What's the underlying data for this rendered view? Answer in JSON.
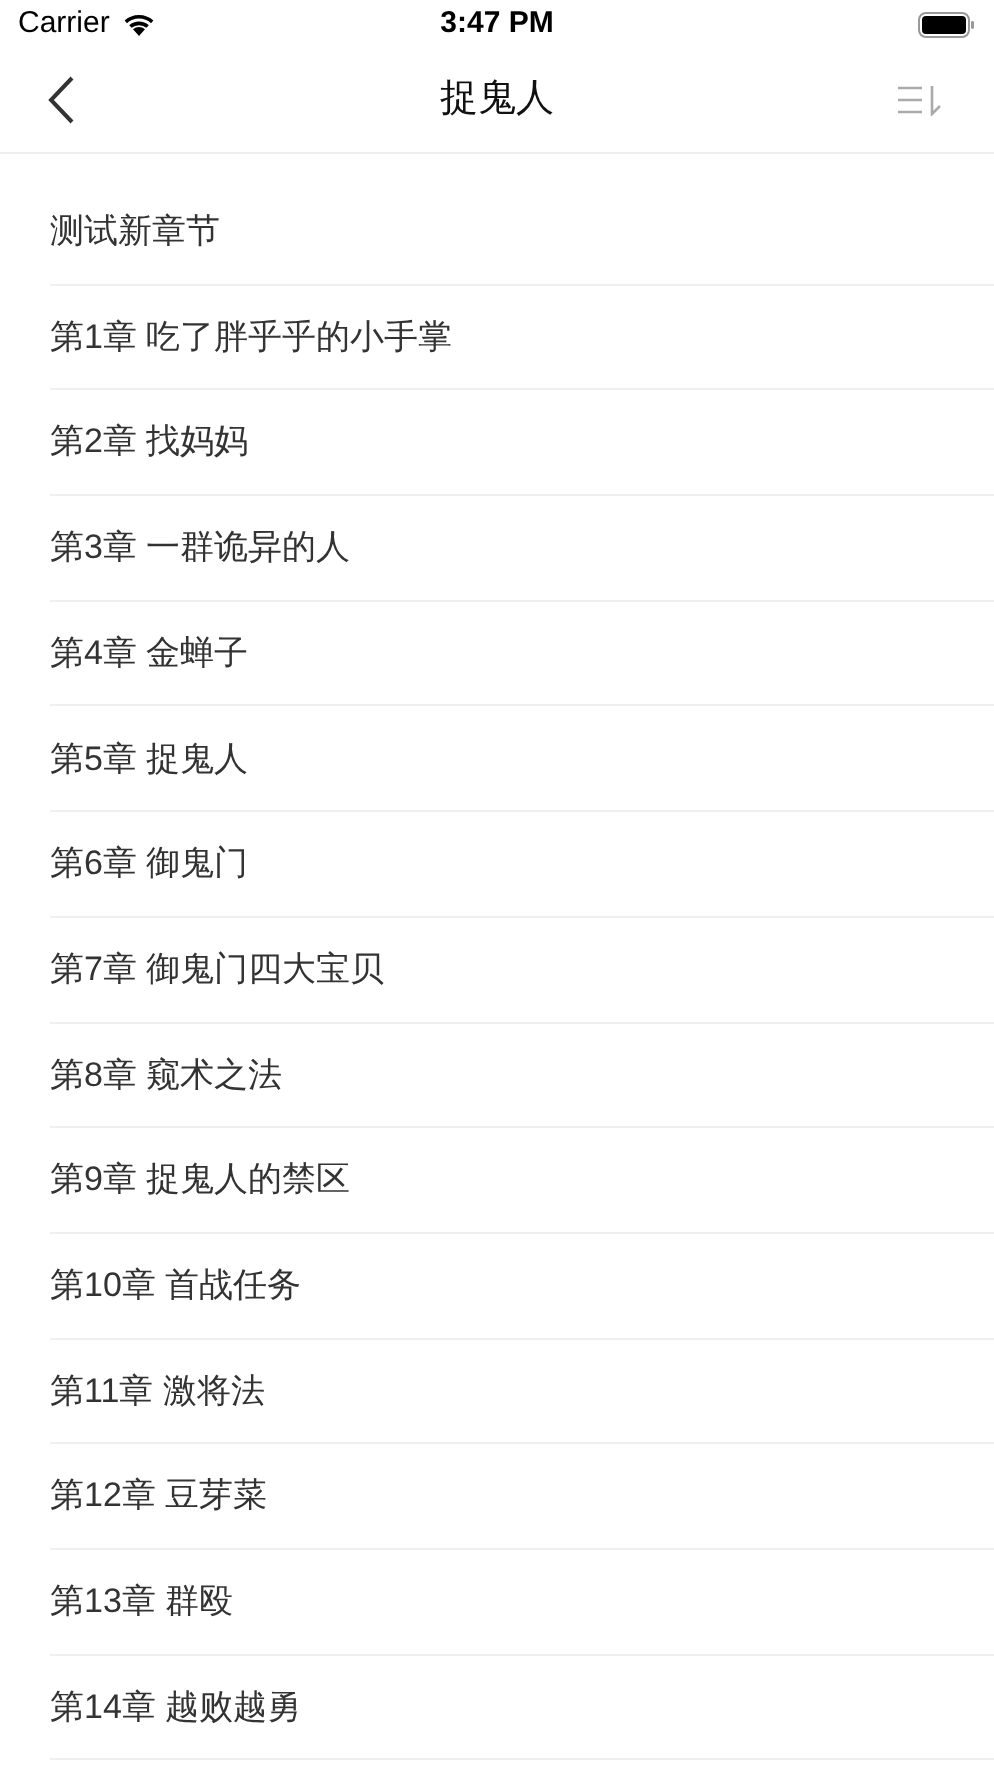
{
  "status_bar": {
    "carrier": "Carrier",
    "time": "3:47 PM"
  },
  "nav_bar": {
    "title": "捉鬼人"
  },
  "chapters": [
    {
      "title": "测试新章节"
    },
    {
      "title": "第1章 吃了胖乎乎的小手掌"
    },
    {
      "title": "第2章 找妈妈"
    },
    {
      "title": "第3章 一群诡异的人"
    },
    {
      "title": "第4章 金蝉子"
    },
    {
      "title": "第5章 捉鬼人"
    },
    {
      "title": "第6章 御鬼门"
    },
    {
      "title": "第7章 御鬼门四大宝贝"
    },
    {
      "title": "第8章 窥术之法"
    },
    {
      "title": "第9章 捉鬼人的禁区"
    },
    {
      "title": "第10章 首战任务"
    },
    {
      "title": "第11章 激将法"
    },
    {
      "title": "第12章 豆芽菜"
    },
    {
      "title": "第13章 群殴"
    },
    {
      "title": "第14章 越败越勇"
    }
  ]
}
